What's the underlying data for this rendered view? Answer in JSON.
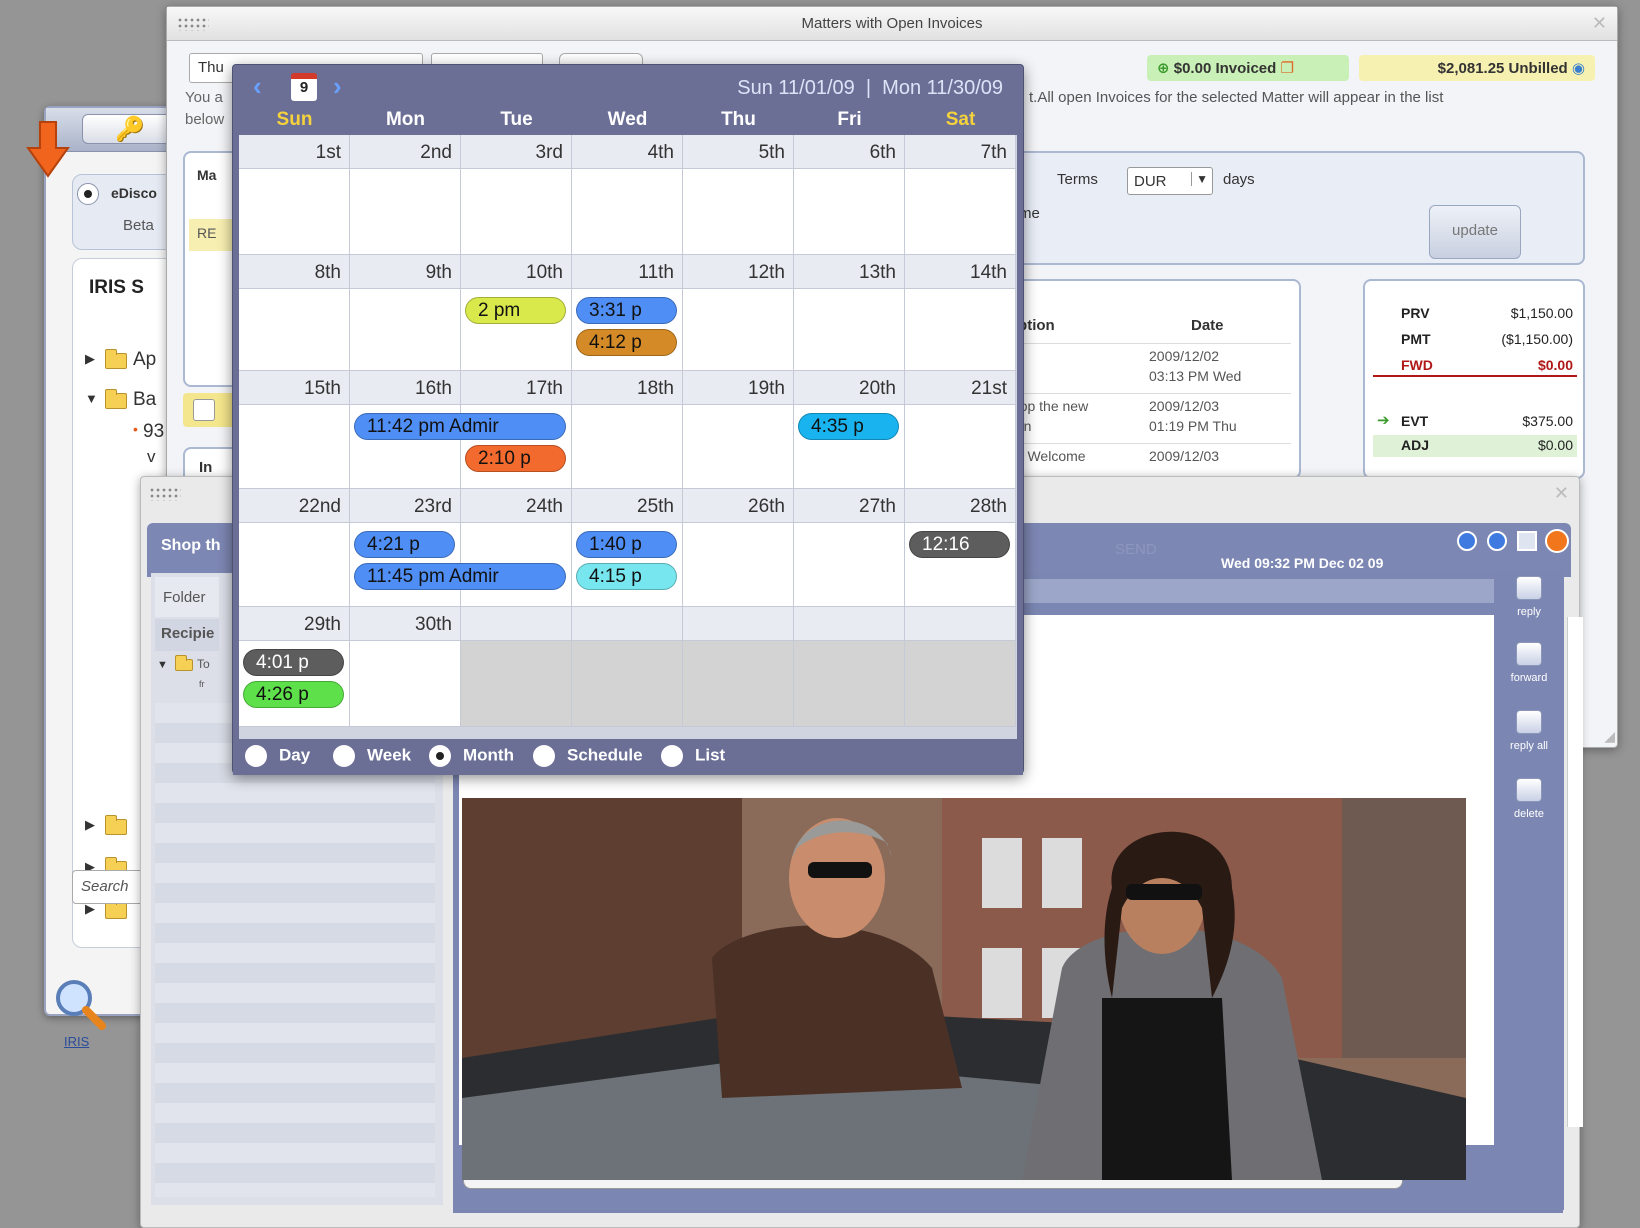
{
  "invoice_window": {
    "title": "Matters with Open Invoices",
    "date_field_prefix": "Thu",
    "invoiced": "$0.00 Invoiced",
    "unbilled": "$2,081.25 Unbilled",
    "notice_left_1": "You a",
    "notice_left_2": "below",
    "notice_right": "t.All open Invoices for the selected Matter will appear in the list",
    "tab_ma": "Ma",
    "row_re": "RE",
    "row_in": "In",
    "terms_label": "Terms",
    "terms_value": "DUR",
    "days_label": "days",
    "message_text": "y pay me",
    "update_button": "update",
    "col_description": "escription",
    "col_date": "Date",
    "rows": [
      {
        "desc": "",
        "date": "2009/12/02",
        "time": "03:13 PM Wed"
      },
      {
        "desc": "nail: Shop the new",
        "desc2": "collection",
        "date": "2009/12/03",
        "time": "01:19 PM Thu"
      },
      {
        "desc": "e Email: Welcome",
        "date": "2009/12/03",
        "time": ""
      }
    ],
    "summary": [
      {
        "code": "PRV",
        "amount": "$1,150.00",
        "color": "#222",
        "bold": false
      },
      {
        "code": "PMT",
        "amount": "($1,150.00)",
        "color": "#222",
        "bold": false
      },
      {
        "code": "FWD",
        "amount": "$0.00",
        "color": "#b01818",
        "bold": true
      },
      {
        "code": "EVT",
        "amount": "$375.00",
        "color": "#222",
        "bold": false
      },
      {
        "code": "ADJ",
        "amount": "$0.00",
        "color": "#222",
        "bold": false
      }
    ]
  },
  "iris_panel": {
    "ediscovery": "eDisco",
    "beta": "Beta",
    "header": "IRIS S",
    "folder1": "Ap",
    "folder2": "Ba",
    "item_number": "93",
    "item_v": "v",
    "search_placeholder": "Search",
    "bottom_label": "IRIS"
  },
  "calendar": {
    "range": "Sun 11/01/09  |  Mon 11/30/09",
    "today_badge": "9",
    "day_names": [
      "Sun",
      "Mon",
      "Tue",
      "Wed",
      "Thu",
      "Fri",
      "Sat"
    ],
    "weeks": [
      [
        "1st",
        "2nd",
        "3rd",
        "4th",
        "5th",
        "6th",
        "7th"
      ],
      [
        "8th",
        "9th",
        "10th",
        "11th",
        "12th",
        "13th",
        "14th"
      ],
      [
        "15th",
        "16th",
        "17th",
        "18th",
        "19th",
        "20th",
        "21st"
      ],
      [
        "22nd",
        "23rd",
        "24th",
        "25th",
        "26th",
        "27th",
        "28th"
      ],
      [
        "29th",
        "30th",
        "",
        "",
        "",
        "",
        ""
      ]
    ],
    "events": [
      {
        "label": "2 pm",
        "color": "#d9e84a"
      },
      {
        "label": "3:31 p",
        "color": "#4f8ff5"
      },
      {
        "label": "4:12 p",
        "color": "#d48a26"
      },
      {
        "label": "11:42 pm  Admir",
        "color": "#4f8ff5"
      },
      {
        "label": "2:10 p",
        "color": "#f26a2e"
      },
      {
        "label": "4:35 p",
        "color": "#19b4f0"
      },
      {
        "label": "4:21 p",
        "color": "#4f8ff5"
      },
      {
        "label": "11:45 pm  Admir",
        "color": "#4f8ff5"
      },
      {
        "label": "1:40 p",
        "color": "#4f8ff5"
      },
      {
        "label": "4:15 p",
        "color": "#78e6ee"
      },
      {
        "label": "12:16",
        "color": "#5d5d5d"
      },
      {
        "label": "4:01 p",
        "color": "#5d5d5d"
      },
      {
        "label": "4:26 p",
        "color": "#5ee04a"
      }
    ],
    "views": [
      "Day",
      "Week",
      "Month",
      "Schedule",
      "List"
    ],
    "selected_view": "Month"
  },
  "mail_window": {
    "subject": "Shop th",
    "folder_label": "Folder",
    "recipient_label": "Recipie",
    "to_label": "To",
    "to_sub": "fr",
    "send_label": "SEND",
    "timestamp": "Wed 09:32 PM  Dec 02 09",
    "tools": [
      "reply",
      "forward",
      "reply all",
      "delete"
    ]
  }
}
